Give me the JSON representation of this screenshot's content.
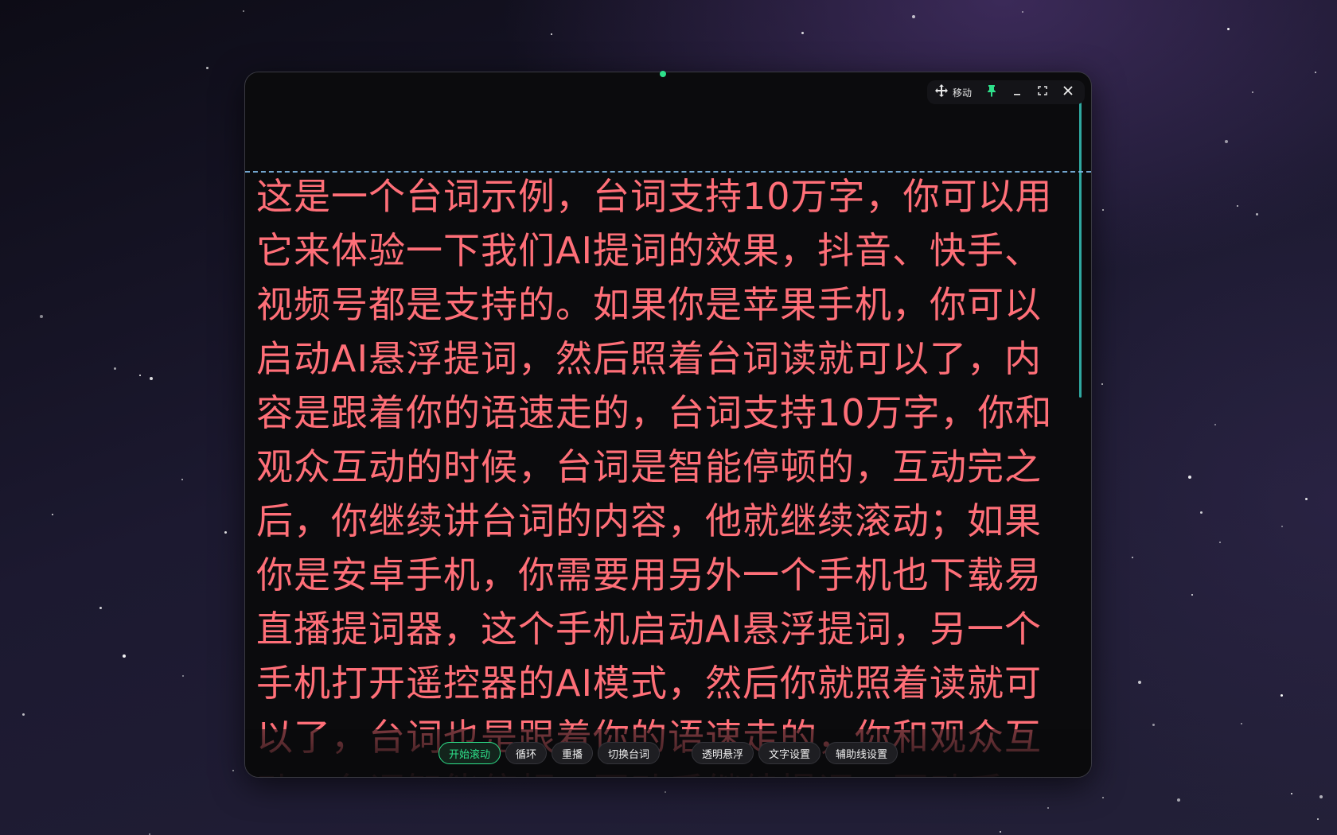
{
  "window": {
    "toolbar": {
      "move_label": "移动",
      "icons": [
        "move-icon",
        "pin-icon",
        "minimize-icon",
        "maximize-icon",
        "close-icon"
      ]
    },
    "script_text": "这是一个台词示例，台词支持10万字，你可以用它来体验一下我们AI提词的效果，抖音、快手、视频号都是支持的。如果你是苹果手机，你可以启动AI悬浮提词，然后照着台词读就可以了，内容是跟着你的语速走的，台词支持10万字，你和观众互动的时候，台词是智能停顿的，互动完之后，你继续讲台词的内容，他就继续滚动；如果你是安卓手机，你需要用另外一个手机也下载易直播提词器，这个手机启动AI悬浮提词，另一个手机打开遥控器的AI模式，然后你就照着读就可以了，台词也是跟着你的语速走的，你和观众互动，台词智能停顿，互动后继续提词，互动后"
  },
  "controls": {
    "start_scroll": "开始滚动",
    "loop": "循环",
    "replay": "重播",
    "switch_script": "切换台词",
    "transparent_float": "透明悬浮",
    "text_settings": "文字设置",
    "guide_settings": "辅助线设置"
  },
  "colors": {
    "script_text": "#ff6f78",
    "accent_green": "#2ee08a",
    "guide_line": "#7fb8e6",
    "scroll_track": "#2fa8a0"
  }
}
